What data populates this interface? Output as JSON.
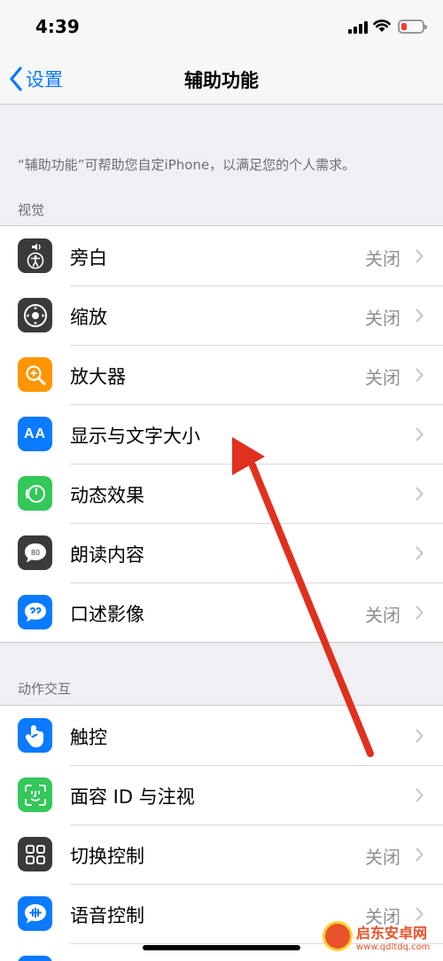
{
  "status_bar": {
    "time": "4:39"
  },
  "nav": {
    "back_label": "设置",
    "title": "辅助功能"
  },
  "description": "“辅助功能”可帮助您自定iPhone，以满足您的个人需求。",
  "sections": [
    {
      "header": "视觉",
      "rows": [
        {
          "label": "旁白",
          "value": "关闭",
          "icon": "voiceover-icon",
          "color": "#3a3a3c"
        },
        {
          "label": "缩放",
          "value": "关闭",
          "icon": "zoom-icon",
          "color": "#3a3a3c"
        },
        {
          "label": "放大器",
          "value": "关闭",
          "icon": "magnifier-icon",
          "color": "#ff9500"
        },
        {
          "label": "显示与文字大小",
          "value": "",
          "icon": "text-size-icon",
          "color": "#0a7aff"
        },
        {
          "label": "动态效果",
          "value": "",
          "icon": "motion-icon",
          "color": "#34c759"
        },
        {
          "label": "朗读内容",
          "value": "",
          "icon": "spoken-content-icon",
          "color": "#3a3a3c"
        },
        {
          "label": "口述影像",
          "value": "关闭",
          "icon": "audio-description-icon",
          "color": "#0a7aff"
        }
      ]
    },
    {
      "header": "动作交互",
      "rows": [
        {
          "label": "触控",
          "value": "",
          "icon": "touch-icon",
          "color": "#0a7aff"
        },
        {
          "label": "面容 ID 与注视",
          "value": "",
          "icon": "face-id-icon",
          "color": "#34c759"
        },
        {
          "label": "切换控制",
          "value": "关闭",
          "icon": "switch-control-icon",
          "color": "#3a3a3c"
        },
        {
          "label": "语音控制",
          "value": "关闭",
          "icon": "voice-control-icon",
          "color": "#0a7aff"
        }
      ]
    }
  ],
  "watermark": {
    "title": "启东安卓网",
    "url": "www.qdltdq.com"
  },
  "annotation_color": "#e0301e"
}
